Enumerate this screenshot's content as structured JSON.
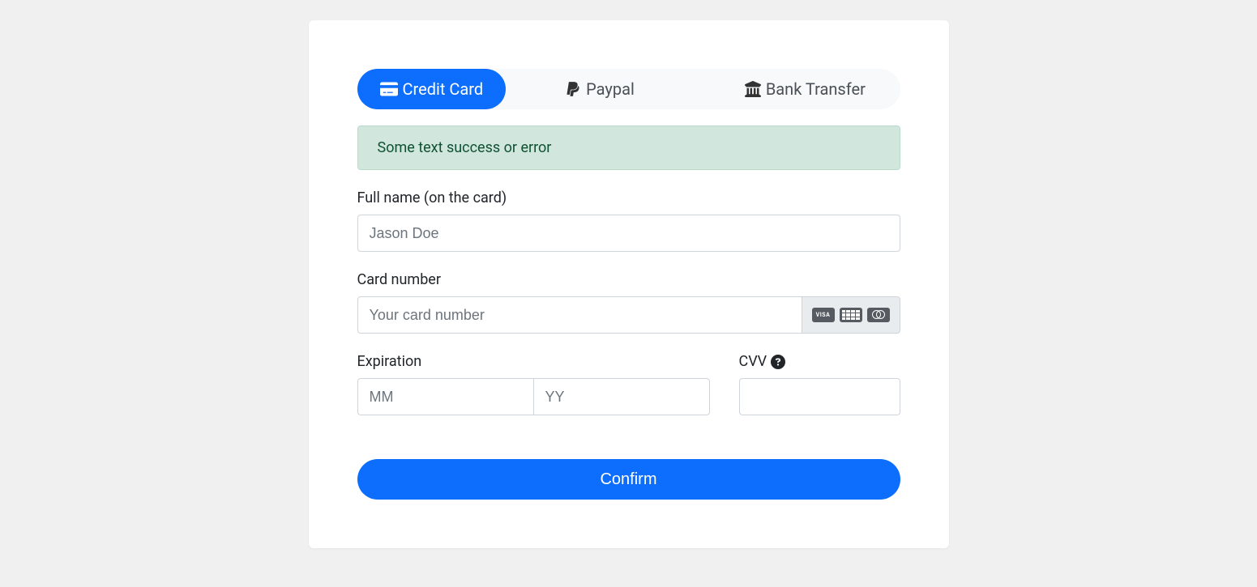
{
  "tabs": [
    {
      "label": "Credit Card",
      "icon": "credit-card-icon",
      "active": true
    },
    {
      "label": "Paypal",
      "icon": "paypal-icon",
      "active": false
    },
    {
      "label": "Bank Transfer",
      "icon": "bank-icon",
      "active": false
    }
  ],
  "alert": {
    "type": "success",
    "text": "Some text success or error"
  },
  "form": {
    "full_name": {
      "label": "Full name (on the card)",
      "placeholder": "Jason Doe",
      "value": ""
    },
    "card_number": {
      "label": "Card number",
      "placeholder": "Your card number",
      "value": "",
      "brands": [
        "VISA",
        "AMEX",
        "MC"
      ]
    },
    "expiration": {
      "label": "Expiration",
      "mm_placeholder": "MM",
      "yy_placeholder": "YY",
      "mm": "",
      "yy": ""
    },
    "cvv": {
      "label": "CVV ",
      "value": ""
    }
  },
  "submit_label": "Confirm"
}
